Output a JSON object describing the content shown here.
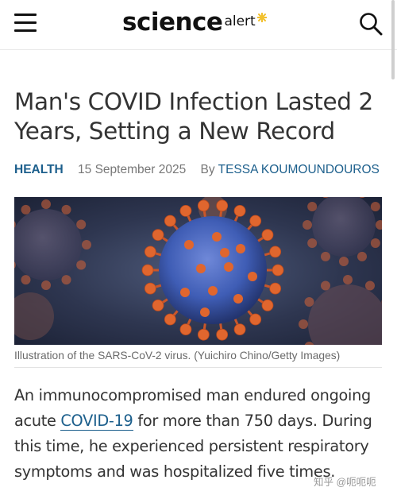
{
  "header": {
    "logo_main": "science",
    "logo_sub": "alert",
    "menu_icon": "hamburger-menu-icon",
    "search_icon": "search-icon"
  },
  "article": {
    "title": "Man's COVID Infection Lasted 2 Years, Setting a New Record",
    "category": "HEALTH",
    "date": "15 September 2025",
    "by": "By",
    "author": "TESSA KOUMOUNDOUROS",
    "image_caption": "Illustration of the SARS-CoV-2 virus. (Yuichiro Chino/Getty Images)",
    "lead_before": "An immunocompromised man endured ongoing acute ",
    "lead_link": "COVID-19",
    "lead_after": " for more than 750 days. During this time, he experienced persistent respiratory symptoms and was hospitalized five times."
  },
  "watermark": "知乎 @呃呃呃",
  "colors": {
    "link": "#1c5f8c",
    "logo_spark": "#f2c12e",
    "virus_body": "#3f5db5",
    "virus_spike": "#e0662e"
  }
}
